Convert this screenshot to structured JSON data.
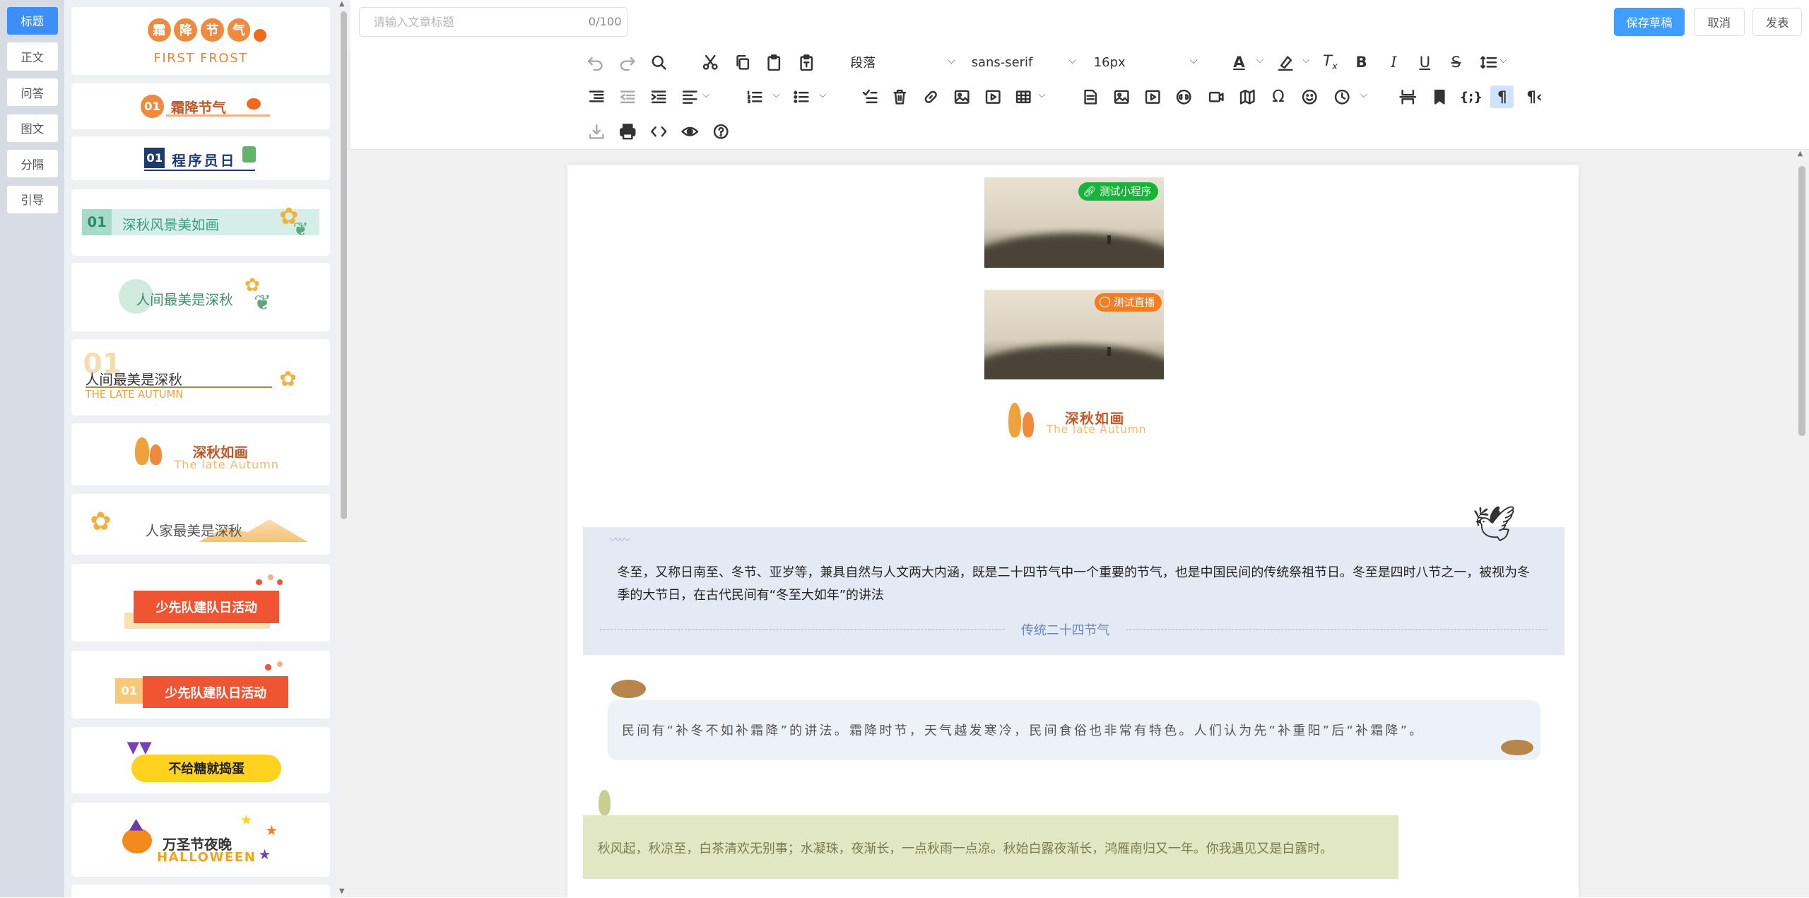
{
  "categories": [
    "标题",
    "正文",
    "问答",
    "图文",
    "分隔",
    "引导"
  ],
  "templates": {
    "t1": {
      "chars": [
        "霜",
        "降",
        "节",
        "气"
      ],
      "sub": "FIRST FROST"
    },
    "t2": {
      "num": "01",
      "text": "霜降节气"
    },
    "t3": {
      "num": "01",
      "text": "程序员日"
    },
    "t4": {
      "num": "01",
      "text": "深秋风景美如画"
    },
    "t5": {
      "text": "人间最美是深秋"
    },
    "t6": {
      "num": "01",
      "text": "人间最美是深秋",
      "sub": "THE LATE AUTUMN"
    },
    "t7": {
      "text": "深秋如画",
      "sub": "The late Autumn"
    },
    "t8": {
      "text": "人家最美是深秋"
    },
    "t9": {
      "text": "少先队建队日活动"
    },
    "t10": {
      "num": "01",
      "text": "少先队建队日活动"
    },
    "t11": {
      "text": "不给糖就捣蛋"
    },
    "t12": {
      "text": "万圣节夜晚",
      "sub": "HALLOWEEN"
    }
  },
  "topbar": {
    "title_placeholder": "请输入文章标题",
    "title_count": "0/100",
    "save_label": "保存草稿",
    "cancel_label": "取消",
    "publish_label": "发表"
  },
  "toolbar": {
    "block_format": "段落",
    "font_family": "sans-serif",
    "font_size": "16px"
  },
  "doc": {
    "mini_badge": "测试小程序",
    "live_badge": "测试直播",
    "header_title": "深秋如画",
    "header_sub": "The late Autumn",
    "para1": "冬至，又称日南至、冬节、亚岁等，兼具自然与人文两大内涵，既是二十四节气中一个重要的节气，也是中国民间的传统祭祖节日。冬至是四时八节之一，被视为冬季的大节日，在古代民间有“冬至大如年”的讲法",
    "para1_caption": "传统二十四节气",
    "para2": "民间有“补冬不如补霜降”的讲法。霜降时节，天气越发寒冷，民间食俗也非常有特色。人们认为先“补重阳”后“补霜降”。",
    "para3": "秋风起，秋凉至，白茶清欢无别事；水凝珠，夜渐长，一点秋雨一点凉。秋始白露夜渐长，鸿雁南归又一年。你我遇见又是白露时。"
  },
  "colors": {
    "accent": "#409eff",
    "nav_active": "#3d8ef8",
    "mini_green": "#19b33c",
    "live_orange": "#f57c1f"
  }
}
